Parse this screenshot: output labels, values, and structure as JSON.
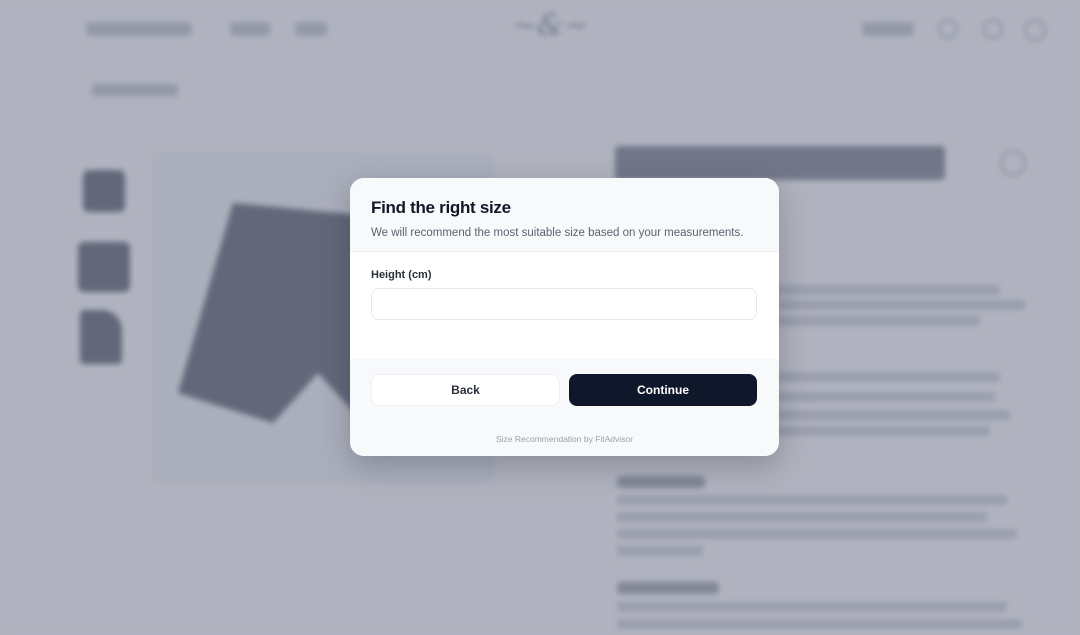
{
  "modal": {
    "title": "Find the right size",
    "subtitle": "We will recommend the most suitable size based on your measurements.",
    "height_field": {
      "label": "Height (cm)",
      "value": "",
      "placeholder": ""
    },
    "back_label": "Back",
    "continue_label": "Continue",
    "powered_by": "Size Recommendation by FitAdvisor"
  },
  "colors": {
    "overlay": "#767b90",
    "primary_button": "#0f172a",
    "product_color": "#4b5060"
  },
  "icons": [
    "search-icon",
    "account-icon",
    "cart-icon",
    "heart-icon"
  ]
}
